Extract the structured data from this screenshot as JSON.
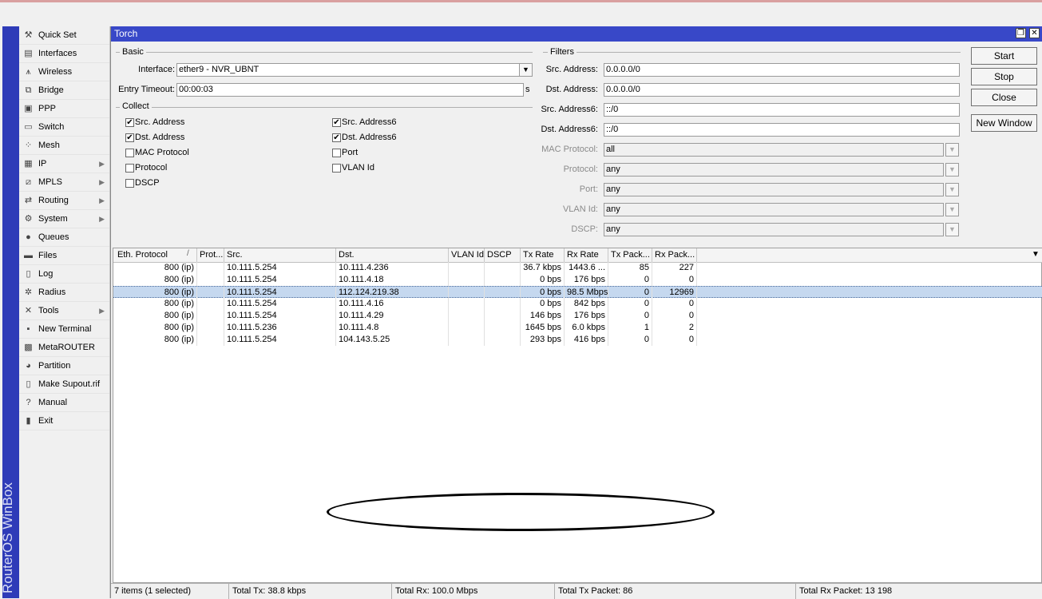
{
  "app": {
    "vertical_title": "RouterOS WinBox"
  },
  "sidebar": {
    "items": [
      {
        "label": "Quick Set",
        "icon": "quick-set-icon",
        "glyph": "⚒",
        "arrow": false
      },
      {
        "label": "Interfaces",
        "icon": "interfaces-icon",
        "glyph": "▤",
        "arrow": false
      },
      {
        "label": "Wireless",
        "icon": "wireless-icon",
        "glyph": "⩚",
        "arrow": false
      },
      {
        "label": "Bridge",
        "icon": "bridge-icon",
        "glyph": "⧉",
        "arrow": false
      },
      {
        "label": "PPP",
        "icon": "ppp-icon",
        "glyph": "▣",
        "arrow": false
      },
      {
        "label": "Switch",
        "icon": "switch-icon",
        "glyph": "▭",
        "arrow": false
      },
      {
        "label": "Mesh",
        "icon": "mesh-icon",
        "glyph": "⁘",
        "arrow": false
      },
      {
        "label": "IP",
        "icon": "ip-icon",
        "glyph": "▦",
        "arrow": true
      },
      {
        "label": "MPLS",
        "icon": "mpls-icon",
        "glyph": "⧄",
        "arrow": true
      },
      {
        "label": "Routing",
        "icon": "routing-icon",
        "glyph": "⇄",
        "arrow": true
      },
      {
        "label": "System",
        "icon": "system-icon",
        "glyph": "⚙",
        "arrow": true
      },
      {
        "label": "Queues",
        "icon": "queues-icon",
        "glyph": "●",
        "arrow": false
      },
      {
        "label": "Files",
        "icon": "files-icon",
        "glyph": "▬",
        "arrow": false
      },
      {
        "label": "Log",
        "icon": "log-icon",
        "glyph": "▯",
        "arrow": false
      },
      {
        "label": "Radius",
        "icon": "radius-icon",
        "glyph": "✲",
        "arrow": false
      },
      {
        "label": "Tools",
        "icon": "tools-icon",
        "glyph": "✕",
        "arrow": true
      },
      {
        "label": "New Terminal",
        "icon": "terminal-icon",
        "glyph": "▪",
        "arrow": false
      },
      {
        "label": "MetaROUTER",
        "icon": "metarouter-icon",
        "glyph": "▩",
        "arrow": false
      },
      {
        "label": "Partition",
        "icon": "partition-icon",
        "glyph": "◕",
        "arrow": false
      },
      {
        "label": "Make Supout.rif",
        "icon": "supout-icon",
        "glyph": "▯",
        "arrow": false
      },
      {
        "label": "Manual",
        "icon": "manual-icon",
        "glyph": "?",
        "arrow": false
      },
      {
        "label": "Exit",
        "icon": "exit-icon",
        "glyph": "▮",
        "arrow": false
      }
    ]
  },
  "window": {
    "title": "Torch",
    "restore_glyph": "❐",
    "close_glyph": "✕"
  },
  "basic": {
    "group_label": "Basic",
    "interface_label": "Interface:",
    "interface_value": "ether9 - NVR_UBNT",
    "timeout_label": "Entry Timeout:",
    "timeout_value": "00:00:03",
    "timeout_unit": "s"
  },
  "collect": {
    "group_label": "Collect",
    "items": [
      {
        "label": "Src. Address",
        "checked": true
      },
      {
        "label": "Dst. Address",
        "checked": true
      },
      {
        "label": "MAC Protocol",
        "checked": false
      },
      {
        "label": "Protocol",
        "checked": false
      },
      {
        "label": "DSCP",
        "checked": false
      },
      {
        "label": "Src. Address6",
        "checked": true
      },
      {
        "label": "Dst. Address6",
        "checked": true
      },
      {
        "label": "Port",
        "checked": false
      },
      {
        "label": "VLAN Id",
        "checked": false
      }
    ]
  },
  "filters": {
    "group_label": "Filters",
    "fields": [
      {
        "label": "Src. Address:",
        "value": "0.0.0.0/0",
        "disabled": false,
        "dropdown": false
      },
      {
        "label": "Dst. Address:",
        "value": "0.0.0.0/0",
        "disabled": false,
        "dropdown": false
      },
      {
        "label": "Src. Address6:",
        "value": "::/0",
        "disabled": false,
        "dropdown": false
      },
      {
        "label": "Dst. Address6:",
        "value": "::/0",
        "disabled": false,
        "dropdown": false
      },
      {
        "label": "MAC Protocol:",
        "value": "all",
        "disabled": true,
        "dropdown": true
      },
      {
        "label": "Protocol:",
        "value": "any",
        "disabled": true,
        "dropdown": true
      },
      {
        "label": "Port:",
        "value": "any",
        "disabled": true,
        "dropdown": true
      },
      {
        "label": "VLAN Id:",
        "value": "any",
        "disabled": true,
        "dropdown": true
      },
      {
        "label": "DSCP:",
        "value": "any",
        "disabled": true,
        "dropdown": true
      }
    ]
  },
  "buttons": {
    "start": "Start",
    "stop": "Stop",
    "close": "Close",
    "new_window": "New Window"
  },
  "table": {
    "columns": [
      "Eth. Protocol",
      "Prot...",
      "Src.",
      "Dst.",
      "VLAN Id",
      "DSCP",
      "Tx Rate",
      "Rx Rate",
      "Tx Pack...",
      "Rx Pack..."
    ],
    "sort_indicator": "/",
    "menu_glyph": "▼",
    "rows": [
      {
        "eth": "800 (ip)",
        "prot": "",
        "src": "10.111.5.254",
        "dst": "10.111.4.236",
        "vlan": "",
        "dscp": "",
        "tx": "36.7 kbps",
        "rx": "1443.6 ...",
        "txp": "85",
        "rxp": "227",
        "selected": false
      },
      {
        "eth": "800 (ip)",
        "prot": "",
        "src": "10.111.5.254",
        "dst": "10.111.4.18",
        "vlan": "",
        "dscp": "",
        "tx": "0 bps",
        "rx": "176 bps",
        "txp": "0",
        "rxp": "0",
        "selected": false
      },
      {
        "eth": "800 (ip)",
        "prot": "",
        "src": "10.111.5.254",
        "dst": "112.124.219.38",
        "vlan": "",
        "dscp": "",
        "tx": "0 bps",
        "rx": "98.5 Mbps",
        "txp": "0",
        "rxp": "12969",
        "selected": true
      },
      {
        "eth": "800 (ip)",
        "prot": "",
        "src": "10.111.5.254",
        "dst": "10.111.4.16",
        "vlan": "",
        "dscp": "",
        "tx": "0 bps",
        "rx": "842 bps",
        "txp": "0",
        "rxp": "0",
        "selected": false
      },
      {
        "eth": "800 (ip)",
        "prot": "",
        "src": "10.111.5.254",
        "dst": "10.111.4.29",
        "vlan": "",
        "dscp": "",
        "tx": "146 bps",
        "rx": "176 bps",
        "txp": "0",
        "rxp": "0",
        "selected": false
      },
      {
        "eth": "800 (ip)",
        "prot": "",
        "src": "10.111.5.236",
        "dst": "10.111.4.8",
        "vlan": "",
        "dscp": "",
        "tx": "1645 bps",
        "rx": "6.0 kbps",
        "txp": "1",
        "rxp": "2",
        "selected": false
      },
      {
        "eth": "800 (ip)",
        "prot": "",
        "src": "10.111.5.254",
        "dst": "104.143.5.25",
        "vlan": "",
        "dscp": "",
        "tx": "293 bps",
        "rx": "416 bps",
        "txp": "0",
        "rxp": "0",
        "selected": false
      }
    ]
  },
  "status": {
    "items": "7 items (1 selected)",
    "total_tx": "Total Tx: 38.8 kbps",
    "total_rx": "Total Rx: 100.0 Mbps",
    "total_tx_packet": "Total Tx Packet: 86",
    "total_rx_packet": "Total Rx Packet: 13 198"
  }
}
